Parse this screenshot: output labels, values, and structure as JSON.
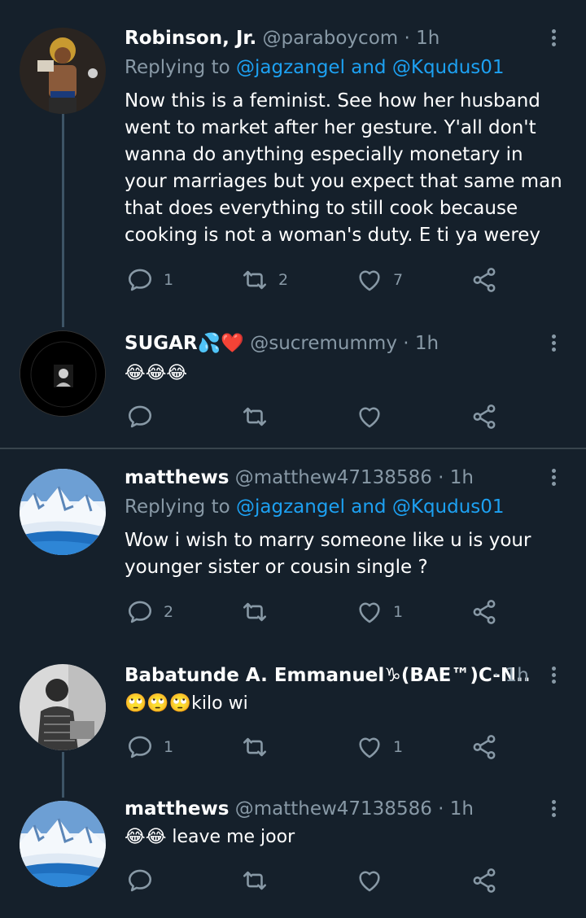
{
  "tweets": [
    {
      "name": "Robinson, Jr.",
      "handle": "@paraboycom",
      "time": "1h",
      "replying_prefix": "Replying to",
      "replying_users": [
        "@jagzangel",
        "@Kqudus01"
      ],
      "replying_and": "and",
      "text": "Now this is a feminist. See how her husband went to market after her gesture. Y'all don't wanna do anything especially monetary in your marriages but you expect that same man that does everything to still cook because cooking is not a woman's duty. E ti ya werey",
      "replies": "1",
      "retweets": "2",
      "likes": "7"
    },
    {
      "name": "SUGAR💦❤️",
      "handle": "@sucremummy",
      "time": "1h",
      "text": "😂😂😂",
      "replies": "",
      "retweets": "",
      "likes": ""
    },
    {
      "name": "matthews",
      "handle": "@matthew47138586",
      "time": "1h",
      "replying_prefix": "Replying to",
      "replying_users": [
        "@jagzangel",
        "@Kqudus01"
      ],
      "replying_and": "and",
      "text": "Wow i wish to marry someone like u is your younger sister or cousin single ?",
      "replies": "2",
      "retweets": "",
      "likes": "1"
    },
    {
      "name": "Babatunde A. Emmanuel♑(BAE™)C-N...",
      "handle": "",
      "time": "1h",
      "text": "🙄🙄🙄kilo wi",
      "replies": "1",
      "retweets": "",
      "likes": "1"
    },
    {
      "name": "matthews",
      "handle": "@matthew47138586",
      "time": "1h",
      "text": "😂😂 leave me joor",
      "replies": "",
      "retweets": "",
      "likes": ""
    }
  ],
  "separator": "·",
  "colors": {
    "background": "#15202b",
    "secondary_text": "#8899a6",
    "link": "#1da1f2",
    "divider": "#38444d"
  }
}
